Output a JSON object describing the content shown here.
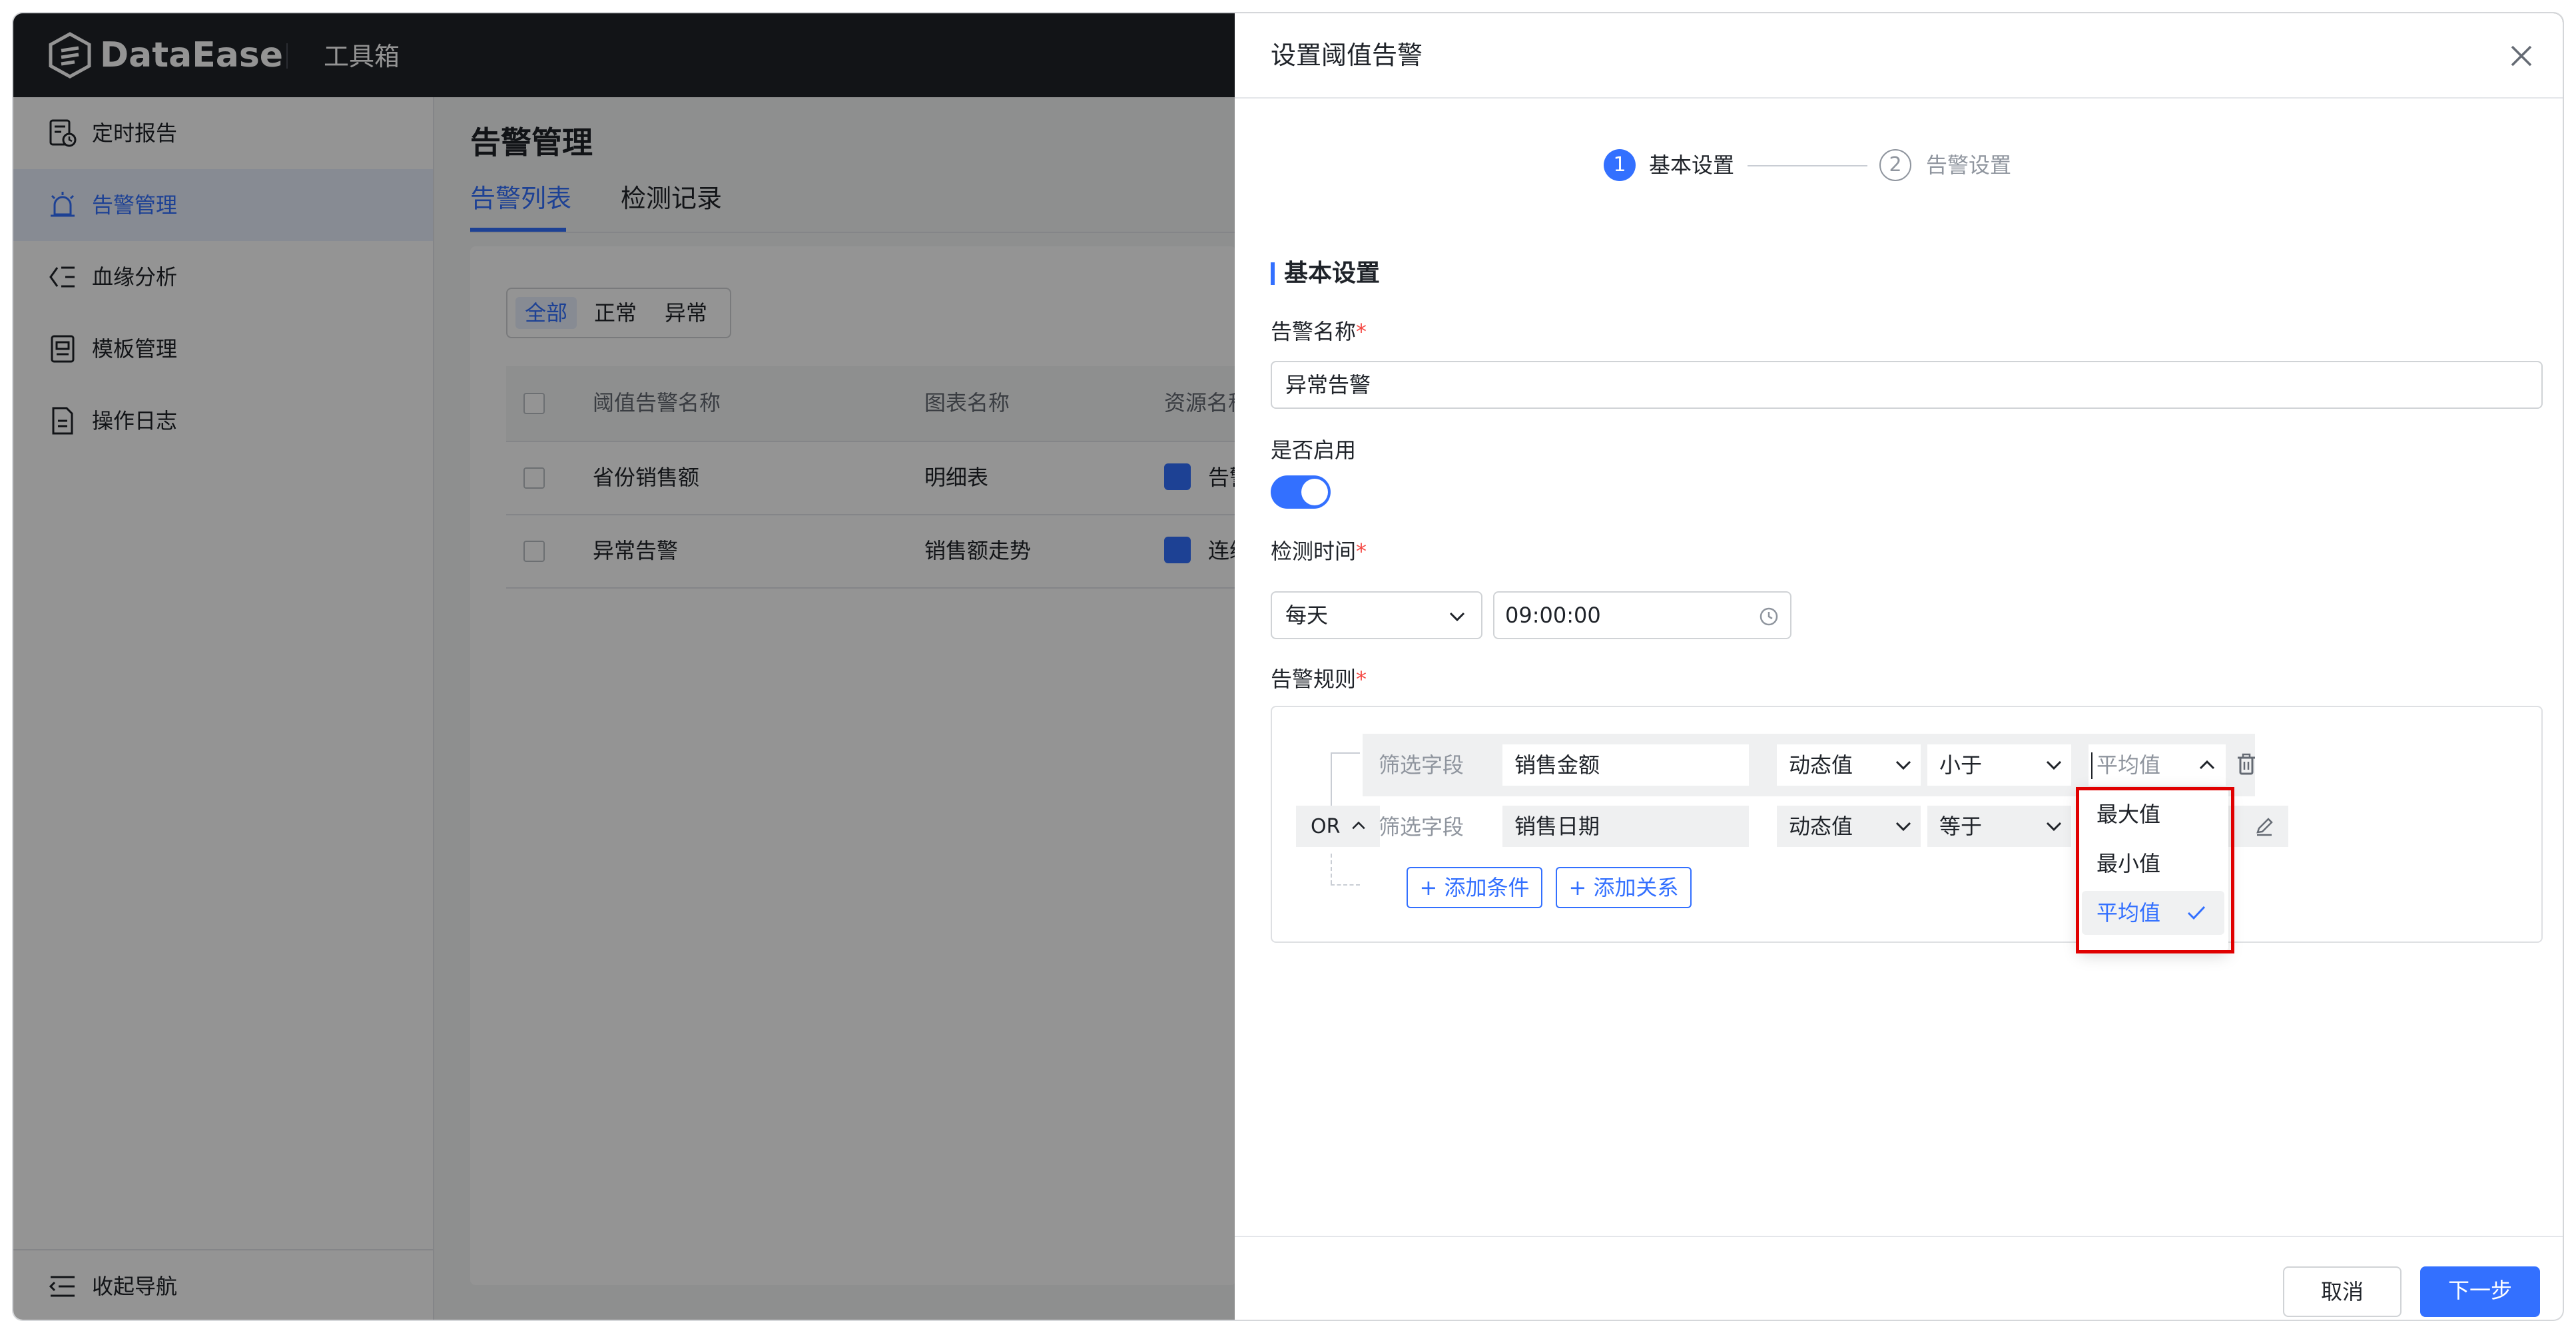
{
  "app": {
    "name": "DataEase",
    "toolbox": "工具箱"
  },
  "sidebar": {
    "items": [
      {
        "label": "定时报告",
        "icon": "report-icon"
      },
      {
        "label": "告警管理",
        "icon": "alarm-icon",
        "active": true
      },
      {
        "label": "血缘分析",
        "icon": "lineage-icon"
      },
      {
        "label": "模板管理",
        "icon": "template-icon"
      },
      {
        "label": "操作日志",
        "icon": "log-icon"
      }
    ],
    "collapse_label": "收起导航"
  },
  "main": {
    "title": "告警管理",
    "tabs": [
      {
        "label": "告警列表",
        "active": true
      },
      {
        "label": "检测记录"
      }
    ],
    "filter": {
      "options": [
        "全部",
        "正常",
        "异常"
      ],
      "selected": "全部"
    },
    "table": {
      "headers": [
        "阈值告警名称",
        "图表名称",
        "资源名称"
      ],
      "rows": [
        {
          "name": "省份销售额",
          "chart": "明细表",
          "resource": "告警"
        },
        {
          "name": "异常告警",
          "chart": "销售额走势",
          "resource": "连续"
        }
      ]
    }
  },
  "drawer": {
    "title": "设置阈值告警",
    "steps": [
      {
        "num": "1",
        "label": "基本设置",
        "active": true
      },
      {
        "num": "2",
        "label": "告警设置"
      }
    ],
    "section_title": "基本设置",
    "alarm_name": {
      "label": "告警名称",
      "value": "异常告警"
    },
    "enabled": {
      "label": "是否启用",
      "value": true
    },
    "check_time": {
      "label": "检测时间",
      "frequency": "每天",
      "time": "09:00:00"
    },
    "rules": {
      "label": "告警规则",
      "relation": "OR",
      "conditions": [
        {
          "field_label": "筛选字段",
          "field": "销售金额",
          "value_type": "动态值",
          "operator": "小于",
          "value": "平均值",
          "value_is_placeholder": true
        },
        {
          "field_label": "筛选字段",
          "field": "销售日期",
          "value_type": "动态值",
          "operator": "等于"
        }
      ],
      "add_condition": "+ 添加条件",
      "add_relation": "+ 添加关系",
      "dropdown_options": [
        "最大值",
        "最小值",
        "平均值"
      ],
      "dropdown_selected": "平均值"
    },
    "cancel": "取消",
    "next": "下一步"
  },
  "colors": {
    "accent": "#3370ff",
    "topbar": "#1f2329",
    "highlight": "#e00000",
    "required": "#f54a45"
  }
}
